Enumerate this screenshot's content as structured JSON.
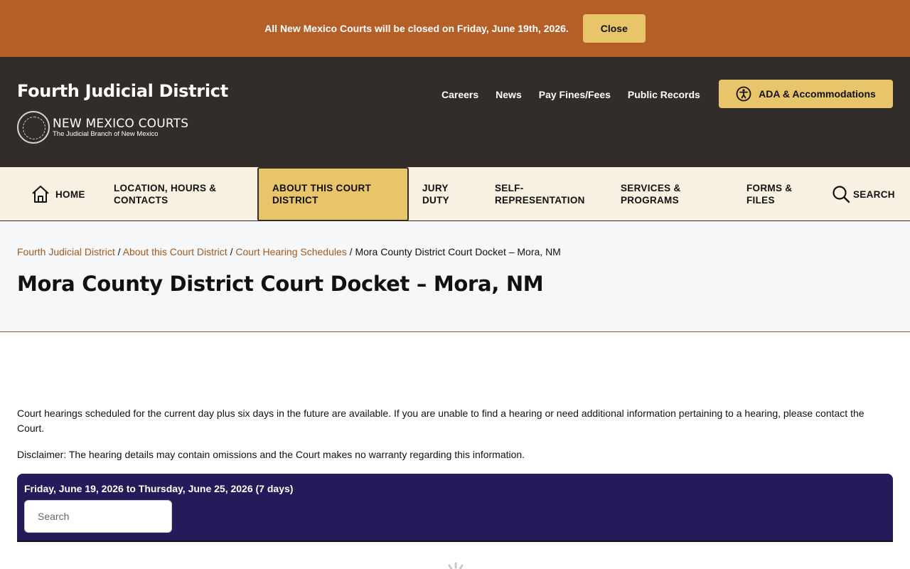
{
  "alert": {
    "message": "All New Mexico Courts will be closed on Friday, June 19th, 2026.",
    "close_label": "Close"
  },
  "header": {
    "site_title": "Fourth Judicial District",
    "logo_main": "NEW MEXICO COURTS",
    "logo_sub": "The Judicial Branch of New Mexico",
    "util_links": [
      "Careers",
      "News",
      "Pay Fines/Fees",
      "Public Records"
    ],
    "ada_label": "ADA & Accommodations"
  },
  "nav": {
    "home": "HOME",
    "location": "LOCATION, HOURS & CONTACTS",
    "about": "ABOUT THIS COURT DISTRICT",
    "jury": "JURY DUTY",
    "self_rep": "SELF-REPRESENTATION",
    "services": "SERVICES & PROGRAMS",
    "forms": "FORMS & FILES",
    "search": "SEARCH"
  },
  "breadcrumb": {
    "items": [
      "Fourth Judicial District",
      "About this Court District",
      "Court Hearing Schedules"
    ],
    "current": "Mora County District Court Docket – Mora, NM"
  },
  "page": {
    "title": "Mora County District Court Docket – Mora, NM",
    "intro": "Court hearings scheduled for the current day plus six days in the future are available. If you are unable to find a hearing or need additional information pertaining to a hearing, please contact the Court.",
    "disclaimer": "Disclaimer:  The hearing details may contain omissions and the Court makes no warranty regarding this information."
  },
  "docket": {
    "range": "Friday, June 19, 2026 to Thursday, June 25, 2026 (7 days)",
    "search_placeholder": "Search"
  },
  "colors": {
    "alert_bg": "#b45f27",
    "header_bg": "#322d29",
    "accent": "#e8c46a",
    "nav_bg": "#f8f0e0",
    "docket_bg": "#271a5b",
    "link": "#a35a1f"
  }
}
